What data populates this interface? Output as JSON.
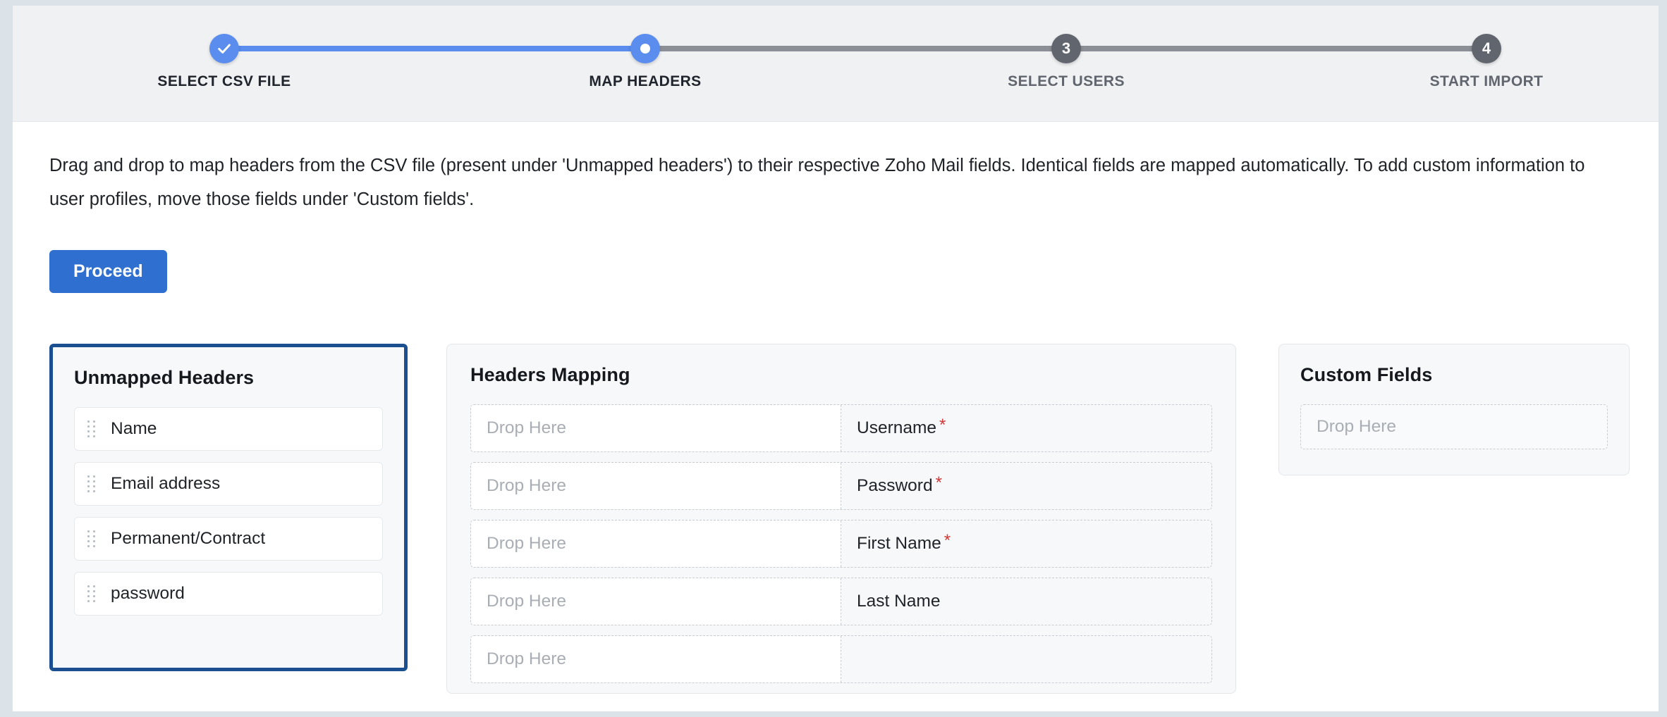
{
  "stepper": {
    "steps": [
      {
        "label": "SELECT CSV FILE",
        "marker": "check",
        "state": "done"
      },
      {
        "label": "MAP HEADERS",
        "marker": "dot",
        "state": "active"
      },
      {
        "label": "SELECT USERS",
        "marker": "3",
        "state": "pending"
      },
      {
        "label": "START IMPORT",
        "marker": "4",
        "state": "pending"
      }
    ],
    "active_color": "#5a8dee",
    "pending_color": "#61656e"
  },
  "instructions": "Drag and drop to map headers from the CSV file (present under 'Unmapped headers') to their respective Zoho Mail fields. Identical fields are mapped automatically. To add custom information to user profiles, move those fields under 'Custom fields'.",
  "proceed_label": "Proceed",
  "unmapped": {
    "title": "Unmapped Headers",
    "items": [
      {
        "label": "Name"
      },
      {
        "label": "Email address"
      },
      {
        "label": "Permanent/Contract"
      },
      {
        "label": "password"
      }
    ]
  },
  "mapping": {
    "title": "Headers Mapping",
    "drop_placeholder": "Drop Here",
    "rows": [
      {
        "drop": "Drop Here",
        "field": "Username",
        "required": true
      },
      {
        "drop": "Drop Here",
        "field": "Password",
        "required": true
      },
      {
        "drop": "Drop Here",
        "field": "First Name",
        "required": true
      },
      {
        "drop": "Drop Here",
        "field": "Last Name",
        "required": false
      },
      {
        "drop": "Drop Here",
        "field": "",
        "required": false
      }
    ]
  },
  "custom": {
    "title": "Custom Fields",
    "drop_placeholder": "Drop Here"
  }
}
